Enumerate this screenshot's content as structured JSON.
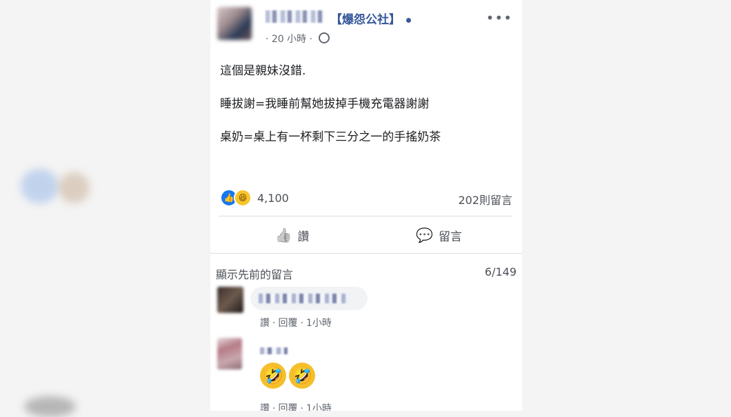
{
  "post": {
    "page_name": "【爆怨公社】",
    "time": "· 20 小時 ·",
    "lines": [
      "這個是親妹沒錯.",
      "睡拔謝=我睡前幫她拔掉手機充電器謝謝",
      "桌奶=桌上有一杯剩下三分之一的手搖奶茶"
    ],
    "reaction_count": "4,100",
    "comment_count": "202則留言",
    "more_label": "•••"
  },
  "actions": {
    "like_label": "讚",
    "comment_label": "留言"
  },
  "comments": {
    "show_previous": "顯示先前的留言",
    "pager": "6/149",
    "items": [
      {
        "action_like": "讚",
        "action_reply": "回覆",
        "time": "1小時"
      },
      {
        "action_like": "讚",
        "action_reply": "回覆",
        "time": "1小時"
      }
    ]
  },
  "icons": {
    "like_icon": "👍",
    "haha_icon": "😆",
    "comment_icon": "💬",
    "laugh_emoji": "🤣"
  }
}
